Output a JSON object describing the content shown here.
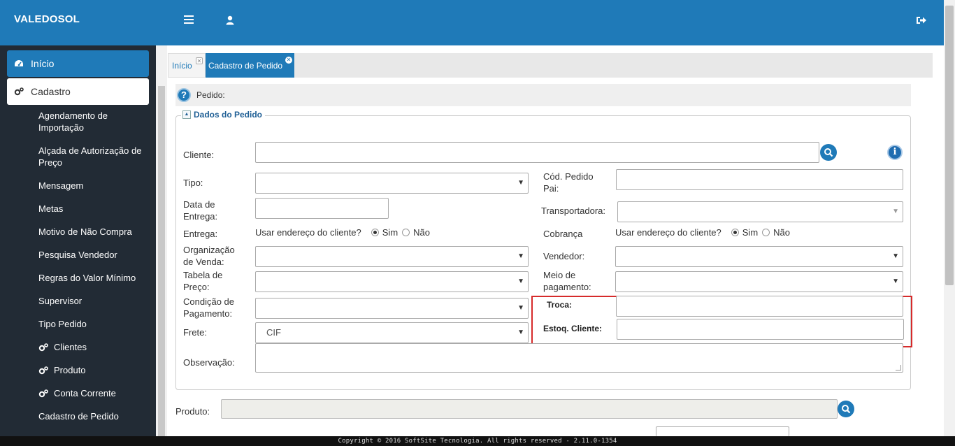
{
  "app": {
    "brand": "VALEDOSOL"
  },
  "sidebar": {
    "main_items": [
      {
        "label": "Início",
        "icon": "dashboard-icon"
      },
      {
        "label": "Cadastro",
        "icon": "gears-icon"
      }
    ],
    "sub_items": [
      {
        "label": "Agendamento de Importação"
      },
      {
        "label": "Alçada de Autorização de Preço"
      },
      {
        "label": "Mensagem"
      },
      {
        "label": "Metas"
      },
      {
        "label": "Motivo de Não Compra"
      },
      {
        "label": "Pesquisa Vendedor"
      },
      {
        "label": "Regras do Valor Mínimo"
      },
      {
        "label": "Supervisor"
      },
      {
        "label": "Tipo Pedido"
      },
      {
        "label": "Clientes",
        "icon": "gears-icon"
      },
      {
        "label": "Produto",
        "icon": "gears-icon"
      },
      {
        "label": "Conta Corrente",
        "icon": "gears-icon"
      },
      {
        "label": "Cadastro de Pedido"
      }
    ]
  },
  "tabs": [
    {
      "label": "Início"
    },
    {
      "label": "Cadastro de Pedido"
    }
  ],
  "page": {
    "header_label": "Pedido:",
    "section_title": "Dados do Pedido"
  },
  "form": {
    "cliente_label": "Cliente:",
    "tipo_label": "Tipo:",
    "cod_pedido_pai_label": "Cód. Pedido Pai:",
    "data_entrega_label": "Data de Entrega:",
    "transportadora_label": "Transportadora:",
    "entrega_label": "Entrega:",
    "entrega_question": "Usar endereço do cliente?",
    "cobranca_label": "Cobrança",
    "cobranca_question": "Usar endereço do cliente?",
    "sim_label": "Sim",
    "nao_label": "Não",
    "org_venda_label": "Organização de Venda:",
    "vendedor_label": "Vendedor:",
    "tabela_preco_label": "Tabela de Preço:",
    "meio_pagamento_label": "Meio de pagamento:",
    "condicao_pagamento_label": "Condição de Pagamento:",
    "troca_label": "Troca:",
    "estoq_cliente_label": "Estoq. Cliente:",
    "frete_label": "Frete:",
    "frete_value": "CIF",
    "observacao_label": "Observação:",
    "produto_label": "Produto:"
  },
  "footer": {
    "text": "Copyright © 2016 SoftSite Tecnologia. All rights reserved - 2.11.0-1354"
  },
  "colors": {
    "primary": "#1f7ab8",
    "sidebar_bg": "#222b35",
    "highlight": "#d62b2b"
  }
}
